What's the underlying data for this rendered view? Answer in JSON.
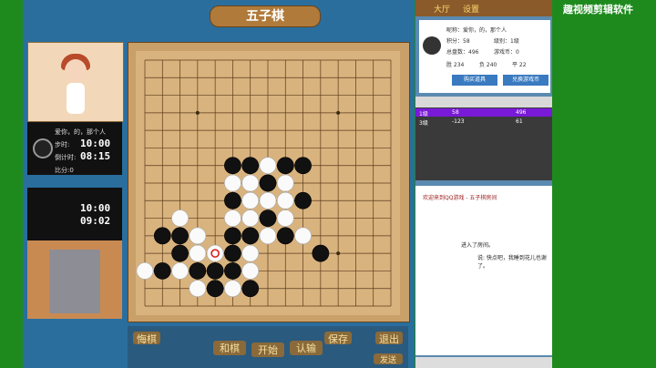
{
  "title": "五子棋",
  "player_top": {
    "label": "爱你，的，那个人",
    "step_label": "步时:",
    "step_time": "10:00",
    "countdown_label": "倒计时:",
    "countdown": "08:15",
    "score_label": "比分:0"
  },
  "player_bottom": {
    "step_time": "10:00",
    "countdown": "09:02"
  },
  "bottom_buttons": {
    "regret": "悔棋",
    "draw": "和棋",
    "start": "开始",
    "resign": "认输",
    "save": "保存",
    "exit": "退出",
    "send": "发送"
  },
  "right_top": {
    "hall": "大厅",
    "settings": "设置"
  },
  "user_card": {
    "nick": "昵称：爱你，的，那个人",
    "score": "积分：58",
    "rank": "级别：1级",
    "total": "总盘数：496",
    "coins": "游戏币：0",
    "wins": "胜 234",
    "losses": "负 240",
    "draws": "平 22",
    "buy_props": "购买道具",
    "exchange": "兑换游戏币"
  },
  "score_table": {
    "row1": {
      "name": "1级",
      "score": "58",
      "total": "496"
    },
    "row2": {
      "name": "3级",
      "score": "-123",
      "total": "61"
    }
  },
  "chat": {
    "welcome": "欢迎来到QQ游戏 - 五子棋房间",
    "joined": "进入了房间。",
    "msg": "说: 快点吧，我睡到花儿也谢了。"
  },
  "overlay_text": "趣视频剪辑软件",
  "board": {
    "black": [
      [
        5,
        6
      ],
      [
        6,
        6
      ],
      [
        8,
        6
      ],
      [
        9,
        6
      ],
      [
        7,
        7
      ],
      [
        5,
        8
      ],
      [
        9,
        8
      ],
      [
        7,
        9
      ],
      [
        1,
        10
      ],
      [
        2,
        10
      ],
      [
        5,
        10
      ],
      [
        6,
        10
      ],
      [
        8,
        10
      ],
      [
        2,
        11
      ],
      [
        3,
        12
      ],
      [
        4,
        12
      ],
      [
        5,
        12
      ],
      [
        1,
        12
      ],
      [
        4,
        13
      ],
      [
        6,
        13
      ],
      [
        5,
        11
      ],
      [
        10,
        11
      ]
    ],
    "white": [
      [
        7,
        6
      ],
      [
        5,
        7
      ],
      [
        6,
        7
      ],
      [
        8,
        7
      ],
      [
        6,
        8
      ],
      [
        7,
        8
      ],
      [
        8,
        8
      ],
      [
        2,
        9
      ],
      [
        5,
        9
      ],
      [
        6,
        9
      ],
      [
        8,
        9
      ],
      [
        3,
        10
      ],
      [
        7,
        10
      ],
      [
        9,
        10
      ],
      [
        3,
        11
      ],
      [
        4,
        11
      ],
      [
        6,
        11
      ],
      [
        0,
        12
      ],
      [
        2,
        12
      ],
      [
        6,
        12
      ],
      [
        3,
        13
      ],
      [
        5,
        13
      ]
    ],
    "marker": [
      4,
      11
    ]
  }
}
